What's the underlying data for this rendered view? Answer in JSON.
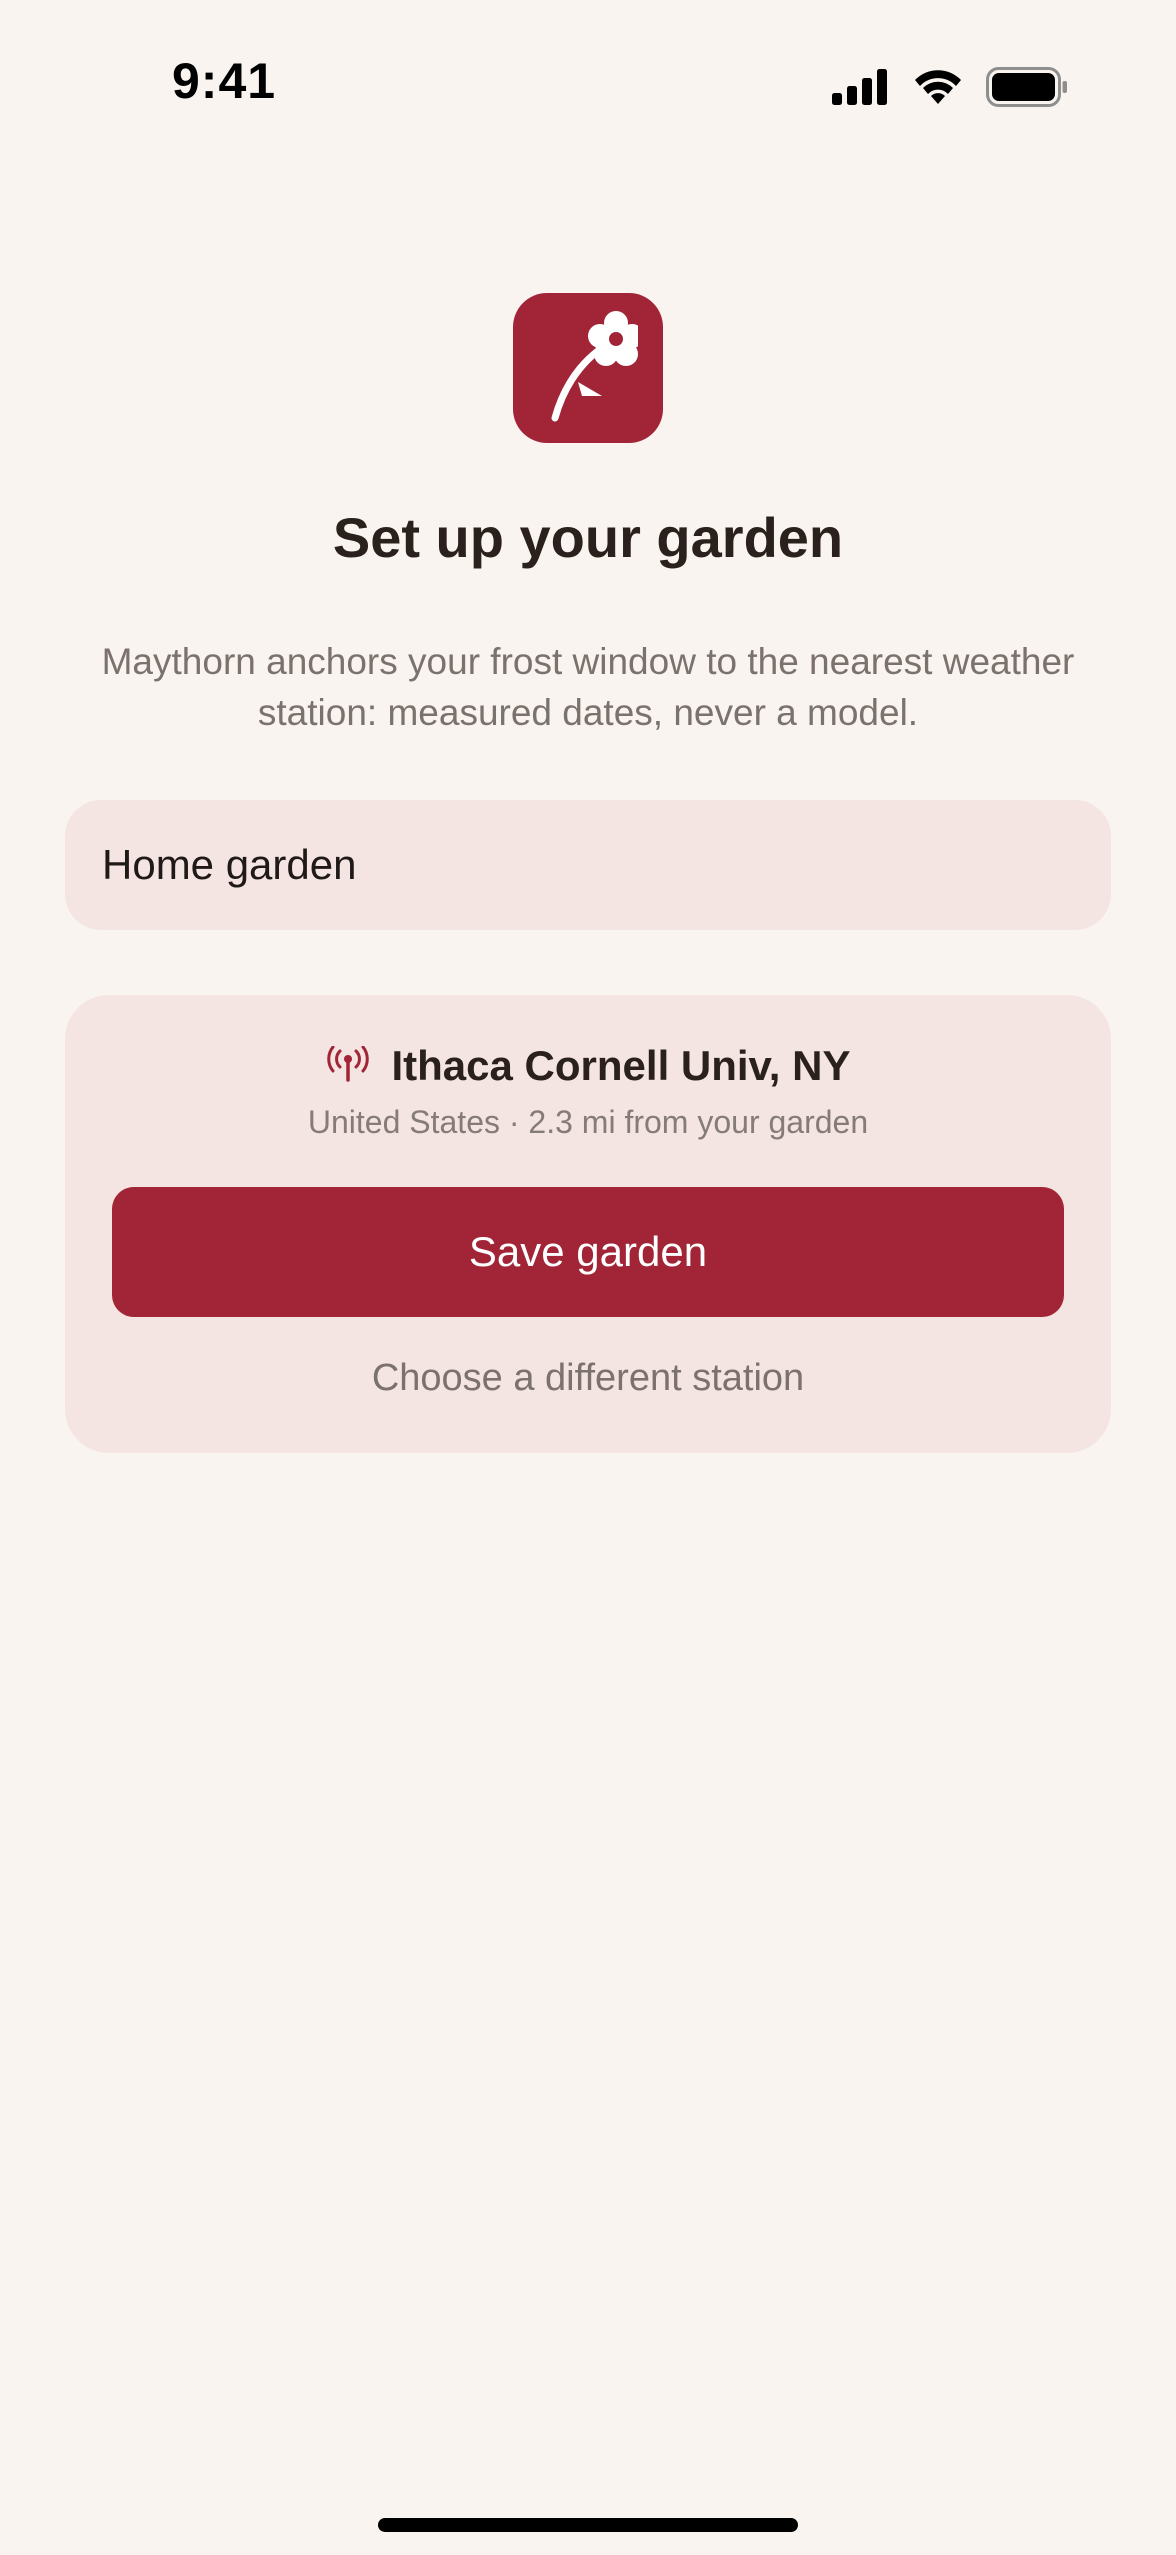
{
  "status_bar": {
    "time": "9:41",
    "icons": [
      "cellular-signal-icon",
      "wifi-icon",
      "battery-icon"
    ]
  },
  "app": {
    "icon": "flower-icon",
    "accent_color": "#a12537",
    "background_color": "#f9f4ef",
    "card_color": "#f4e4e2"
  },
  "header": {
    "title": "Set up your garden",
    "subtitle": "Maythorn anchors your frost window to the nearest weather station: measured dates, never a model."
  },
  "garden_name": {
    "value": "Home garden"
  },
  "station": {
    "icon": "antenna-icon",
    "name": "Ithaca Cornell Univ, NY",
    "meta": "United States · 2.3 mi from your garden",
    "save_label": "Save garden",
    "change_label": "Choose a different station"
  }
}
